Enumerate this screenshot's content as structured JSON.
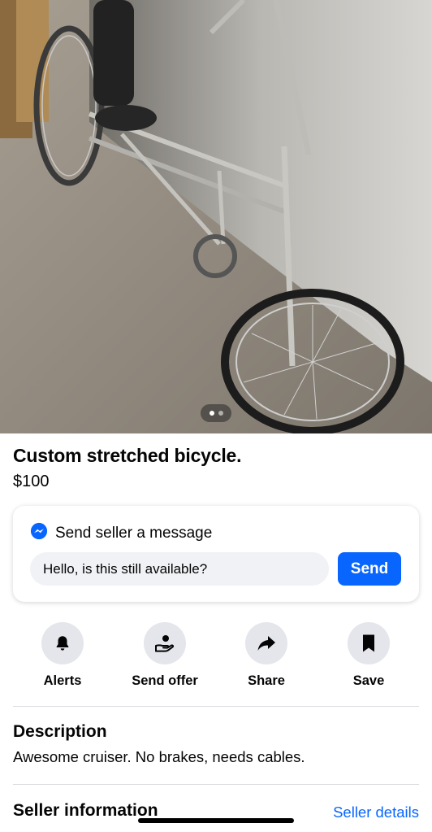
{
  "listing": {
    "title": "Custom stretched bicycle.",
    "price": "$100",
    "photo_pages": 2,
    "photo_active_page": 1
  },
  "message": {
    "header": "Send seller a message",
    "input_value": "Hello, is this still available?",
    "send_label": "Send",
    "icon": "messenger-icon"
  },
  "actions": [
    {
      "label": "Alerts",
      "icon": "bell-icon"
    },
    {
      "label": "Send offer",
      "icon": "offer-icon"
    },
    {
      "label": "Share",
      "icon": "share-arrow-icon"
    },
    {
      "label": "Save",
      "icon": "bookmark-icon"
    }
  ],
  "description": {
    "heading": "Description",
    "text": "Awesome cruiser. No brakes, needs cables."
  },
  "seller": {
    "heading": "Seller information",
    "link": "Seller details"
  },
  "colors": {
    "accent": "#0866ff",
    "icon_bg": "#e4e6eb",
    "input_bg": "#f0f2f5"
  }
}
